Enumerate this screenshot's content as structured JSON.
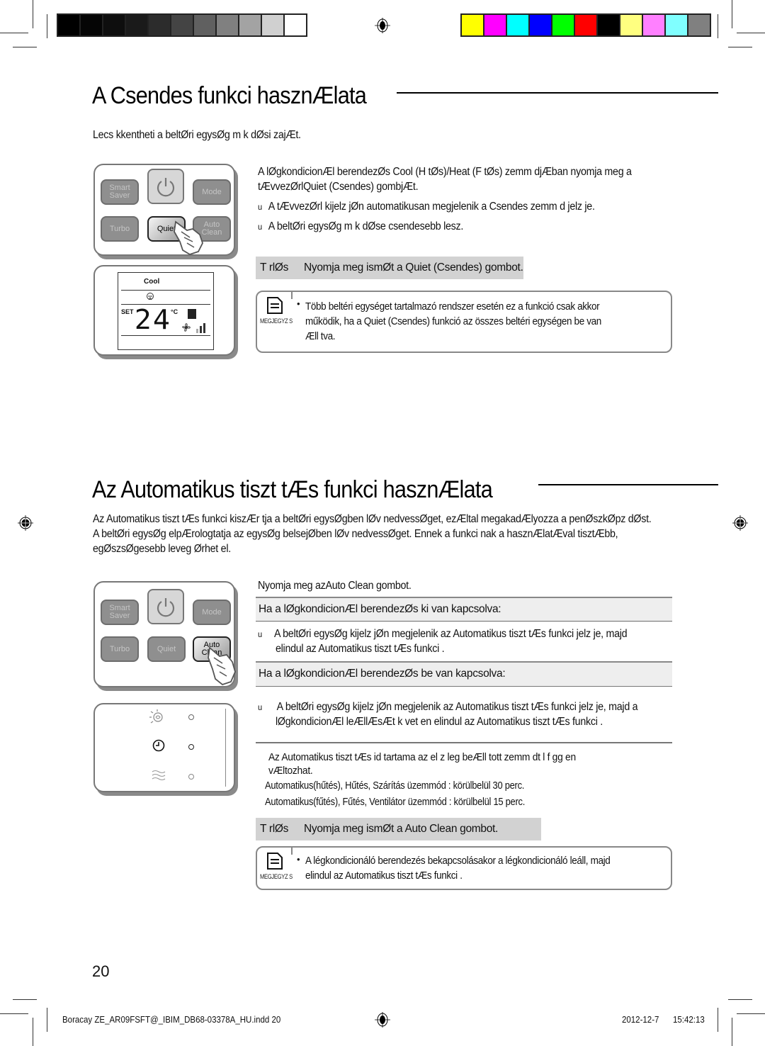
{
  "print_marks": {
    "grayscale_swatches": [
      "#000000",
      "#050505",
      "#0e0e0e",
      "#1a1a1a",
      "#2c2c2c",
      "#444444",
      "#606060",
      "#808080",
      "#a3a3a3",
      "#d0d0d0",
      "#ffffff"
    ],
    "color_swatches": [
      "#ffff00",
      "#ff00ff",
      "#00ffff",
      "#0000ff",
      "#00ff00",
      "#ff0000",
      "#000000",
      "#ffff80",
      "#ff80ff",
      "#80ffff",
      "#808080"
    ]
  },
  "section1": {
    "title": "A Csendes funkci  hasznÆlata",
    "intro": "Lecs kkentheti a beltØri egysØg m k dØsi zajÆt.",
    "step_line1": "A lØgkondicionÆl  berendezØs Cool (H tØs)/Heat (F tØs)  zemm djÆban nyomja meg a",
    "step_line2": "tÆvvezØrlQuiet  (Csendes) gombjÆt.",
    "bullets": [
      "A tÆvvezØrl  kijelz jØn automatikusan megjelenik a Csendes  zemm d jelz je.",
      "A beltØri egysØg m k dØse csendesebb lesz."
    ],
    "bullet_marker": "u",
    "cancel_label": "T rlØs",
    "cancel_text": "Nyomja meg ismØt a Quiet  (Csendes) gombot.",
    "note": {
      "label": "MEGJEGYZ S",
      "bullet": "•",
      "lines": [
        "Több beltéri egységet tartalmazó rendszer esetén ez a funkció csak akkor",
        "működik, ha a Quiet (Csendes) funkció az összes beltéri egységen be van",
        "Æll tva."
      ]
    },
    "remote": {
      "buttons": {
        "smart_saver": "Smart\nSaver",
        "power": "power",
        "mode": "Mode",
        "turbo": "Turbo",
        "quiet": "Quiet",
        "auto_clean": "Auto\nClean"
      },
      "pressed": "Quiet"
    },
    "display": {
      "mode": "Cool",
      "set_label": "SET",
      "temperature": "24",
      "unit": "°C"
    }
  },
  "section2": {
    "title": "Az Automatikus tiszt tÆs funkci  hasznÆlata",
    "intro_lines": [
      "Az Automatikus tiszt tÆs funkci  kiszÆr tja a beltØri egysØgben lØv  nedvessØget, ezÆltal megakadÆlyozza a penØszkØpz dØst.",
      "A beltØri egysØg elpÆrologtatja az egysØg belsejØben lØv  nedvessØget. Ennek a funkci nak a hasznÆlatÆval tisztÆbb,",
      "egØszsØgesebb leveg  Ørhet  el."
    ],
    "step": "Nyomja meg azAuto Clean gombot.",
    "case_off_header": "Ha a lØgkondicionÆl  berendezØs ki van kapcsolva:",
    "case_off_bullet": [
      "A beltØri egysØg kijelz jØn megjelenik az Automatikus tiszt tÆs funkci  jelz je, majd",
      "elindul az Automatikus tiszt tÆs funkci ."
    ],
    "case_on_header": "Ha a lØgkondicionÆl  berendezØs be van kapcsolva:",
    "case_on_bullet": [
      "A beltØri egysØg kijelz jØn megjelenik az Automatikus tiszt tÆs funkci  jelz je, majd a",
      "lØgkondicionÆl  leÆllÆsÆt k vet en elindul az Automatikus tiszt tÆs funkci ."
    ],
    "bullet_marker": "u",
    "duration_lines": [
      "Az Automatikus tiszt tÆs id tartama az el z leg beÆll tott  zemm dt l f gg en",
      "vÆltozhat."
    ],
    "duration_items": [
      "Automatikus(hűtés), Hűtés, Szárítás üzemmód : körülbelül 30 perc.",
      "Automatikus(fűtés), Fűtés, Ventilátor üzemmód : körülbelül 15 perc."
    ],
    "cancel_label": "T rlØs",
    "cancel_text": "Nyomja meg ismØt a Auto Clean gombot.",
    "note": {
      "label": "MEGJEGYZ S",
      "bullet": "•",
      "lines": [
        "A légkondicionáló berendezés bekapcsolásakor a légkondicionáló leáll, majd",
        "elindul az Automatikus tiszt tÆs funkci ."
      ]
    },
    "remote": {
      "buttons": {
        "smart_saver": "Smart\nSaver",
        "power": "power",
        "mode": "Mode",
        "turbo": "Turbo",
        "quiet": "Quiet",
        "auto_clean": "Auto\nClean"
      },
      "pressed": "Auto Clean"
    },
    "indicator_panel": {
      "icons": [
        "auto-clean-icon",
        "timer-icon",
        "wave-icon"
      ]
    }
  },
  "page_number": "20",
  "footer": {
    "file": "Boracay ZE_AR09FSFT@_IBIM_DB68-03378A_HU.indd   20",
    "date": "2012-12-7",
    "time": "15:42:13"
  }
}
